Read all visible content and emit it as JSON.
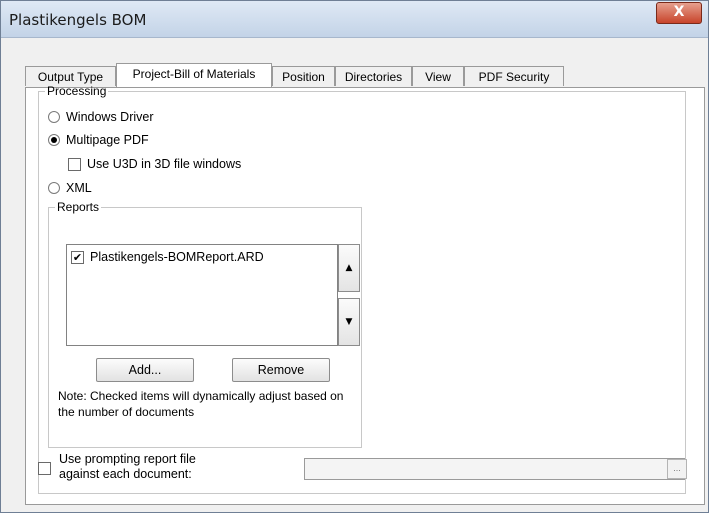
{
  "window": {
    "title": "Plastikengels BOM",
    "close_label": "X"
  },
  "tabs": [
    {
      "label": "Output Type",
      "active": false
    },
    {
      "label": "Project-Bill of Materials",
      "active": true
    },
    {
      "label": "Position",
      "active": false
    },
    {
      "label": "Directories",
      "active": false
    },
    {
      "label": "View",
      "active": false
    },
    {
      "label": "PDF Security",
      "active": false
    }
  ],
  "processing": {
    "legend": "Processing",
    "windows_driver": {
      "label": "Windows Driver",
      "checked": false
    },
    "multipage_pdf": {
      "label": "Multipage PDF",
      "checked": true
    },
    "use_u3d": {
      "label": "Use U3D in 3D file windows",
      "checked": false
    },
    "xml": {
      "label": "XML",
      "checked": false
    }
  },
  "reports": {
    "legend": "Reports",
    "items": [
      {
        "label": "Plastikengels-BOMReport.ARD",
        "checked": true
      }
    ],
    "check_mark": "✔",
    "up_arrow": "▲",
    "down_arrow": "▼",
    "add_label": "Add...",
    "remove_label": "Remove",
    "note": "Note: Checked items will dynamically adjust based on the number of documents"
  },
  "prompting": {
    "label_line1": "Use prompting report file",
    "label_line2": "against each document:",
    "checked": false,
    "path_value": "",
    "browse_label": "..."
  }
}
